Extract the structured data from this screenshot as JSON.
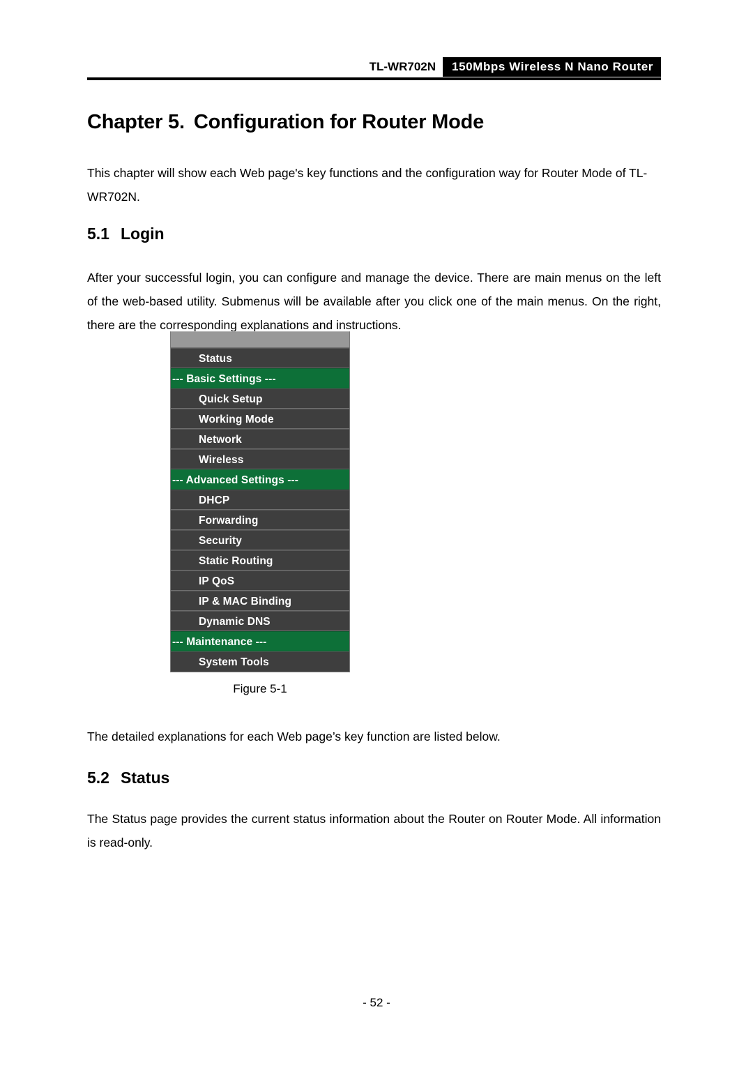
{
  "header": {
    "model": "TL-WR702N",
    "tagline": "150Mbps Wireless N Nano Router"
  },
  "chapter": {
    "label": "Chapter 5.",
    "title": "Configuration for Router Mode"
  },
  "paragraphs": {
    "intro": "This chapter will show each Web page's key functions and the configuration way for Router Mode of TL-WR702N.",
    "login": "After your successful login, you can configure and manage the device. There are main menus on the left of the web-based utility. Submenus will be available after you click one of the main menus. On the right, there are the corresponding explanations and instructions.",
    "detail": "The detailed explanations for each Web page’s key function are listed below.",
    "status": "The Status page provides the current status information about the Router on Router Mode. All information is read-only."
  },
  "sections": [
    {
      "number": "5.1",
      "title": "Login"
    },
    {
      "number": "5.2",
      "title": "Status"
    }
  ],
  "figure": {
    "caption": "Figure 5-1",
    "menu": [
      {
        "label": "Status",
        "type": "item"
      },
      {
        "label": "--- Basic Settings ---",
        "type": "section"
      },
      {
        "label": "Quick Setup",
        "type": "item"
      },
      {
        "label": "Working Mode",
        "type": "item"
      },
      {
        "label": "Network",
        "type": "item"
      },
      {
        "label": "Wireless",
        "type": "item"
      },
      {
        "label": "--- Advanced Settings ---",
        "type": "section"
      },
      {
        "label": "DHCP",
        "type": "item"
      },
      {
        "label": "Forwarding",
        "type": "item"
      },
      {
        "label": "Security",
        "type": "item"
      },
      {
        "label": "Static Routing",
        "type": "item"
      },
      {
        "label": "IP QoS",
        "type": "item"
      },
      {
        "label": "IP & MAC Binding",
        "type": "item"
      },
      {
        "label": "Dynamic DNS",
        "type": "item"
      },
      {
        "label": "--- Maintenance ---",
        "type": "section"
      },
      {
        "label": "System Tools",
        "type": "item"
      }
    ]
  },
  "footer": {
    "page_number": "- 52 -"
  },
  "colors": {
    "menu_item_bg": "#3e3e3e",
    "menu_section_bg": "#0d7038",
    "menu_topbar_bg": "#999999",
    "header_box_bg": "#000000",
    "text": "#000000"
  }
}
